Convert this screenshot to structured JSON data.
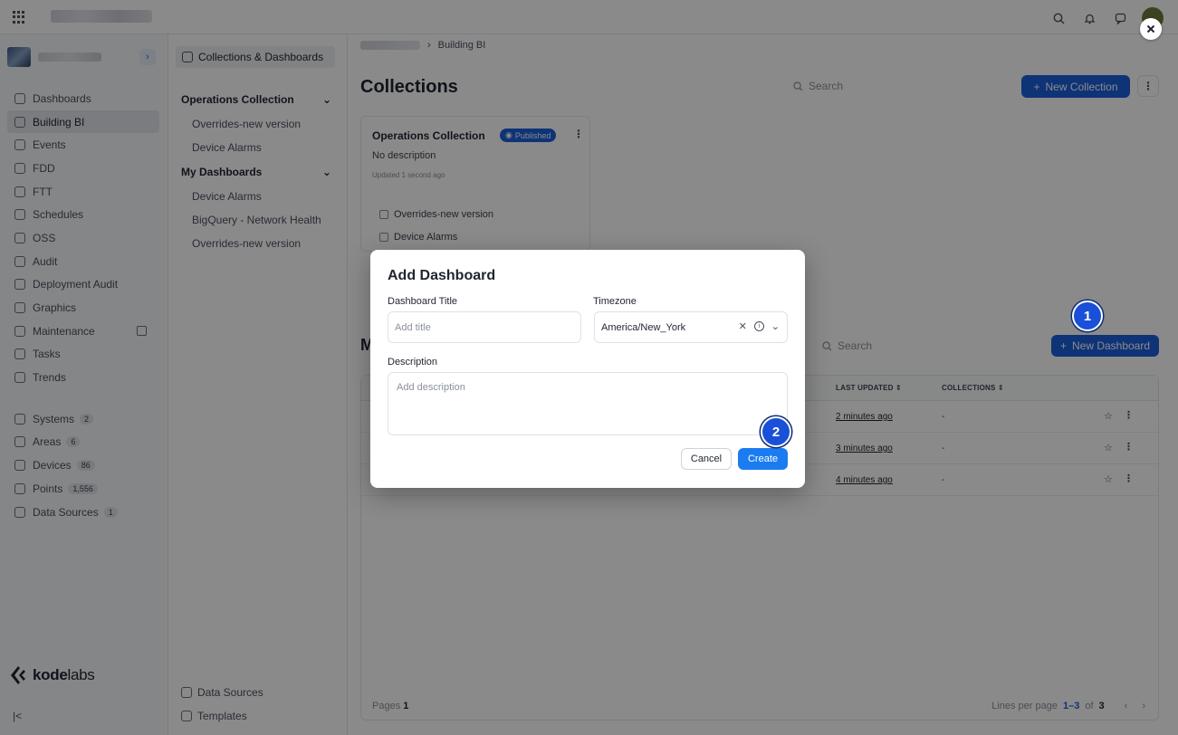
{
  "colors": {
    "accent": "#1a5fdd",
    "create": "#1a7cf0",
    "step_marker": "#1a4fd8"
  },
  "topbar": {
    "icons": [
      "apps-grid-icon",
      "search-icon",
      "bell-icon",
      "chat-icon"
    ]
  },
  "leftnav": {
    "items": [
      {
        "label": "Dashboards",
        "icon": "grid-icon"
      },
      {
        "label": "Building BI",
        "icon": "chart-icon"
      },
      {
        "label": "Events",
        "icon": "events-icon"
      },
      {
        "label": "FDD",
        "icon": "fdd-icon"
      },
      {
        "label": "FTT",
        "icon": "ftt-icon"
      },
      {
        "label": "Schedules",
        "icon": "calendar-icon"
      },
      {
        "label": "OSS",
        "icon": "clock-icon"
      },
      {
        "label": "Audit",
        "icon": "audit-icon"
      },
      {
        "label": "Deployment Audit",
        "icon": "deploy-icon"
      },
      {
        "label": "Graphics",
        "icon": "graphics-icon"
      },
      {
        "label": "Maintenance",
        "icon": "maintenance-icon"
      },
      {
        "label": "Tasks",
        "icon": "tasks-icon"
      },
      {
        "label": "Trends",
        "icon": "trends-icon"
      }
    ],
    "items2": [
      {
        "label": "Systems",
        "badge": "2"
      },
      {
        "label": "Areas",
        "badge": "6"
      },
      {
        "label": "Devices",
        "badge": "86"
      },
      {
        "label": "Points",
        "badge": "1,556"
      },
      {
        "label": "Data Sources",
        "badge": "1"
      }
    ],
    "logo_bold": "kode",
    "logo_light": "labs"
  },
  "secondary": {
    "header": "Collections & Dashboards",
    "group1": "Operations Collection",
    "group1_items": [
      "Overrides-new version",
      "Device Alarms"
    ],
    "group2": "My Dashboards",
    "group2_items": [
      "Device Alarms",
      "BigQuery - Network Health",
      "Overrides-new version"
    ],
    "footer": [
      "Data Sources",
      "Templates"
    ]
  },
  "main": {
    "breadcrumb_current": "Building BI",
    "title": "Collections",
    "search_placeholder": "Search",
    "new_collection": "New Collection",
    "card": {
      "title": "Operations Collection",
      "badge": "Published",
      "description": "No description",
      "updated": "Updated 1 second ago",
      "items": [
        "Overrides-new version",
        "Device Alarms"
      ]
    },
    "section2_partial": "M",
    "search2_placeholder": "Search",
    "new_dashboard": "New Dashboard",
    "table": {
      "columns": [
        "LAST UPDATED",
        "COLLECTIONS"
      ],
      "rows": [
        {
          "updated": "2 minutes ago",
          "collections": "-"
        },
        {
          "updated": "3 minutes ago",
          "collections": "-"
        },
        {
          "updated": "4 minutes ago",
          "collections": "-"
        }
      ],
      "pages_label": "Pages",
      "pages_value": "1",
      "lines_label": "Lines per page",
      "range": "1–3",
      "of": "of",
      "total": "3"
    }
  },
  "modal": {
    "title": "Add Dashboard",
    "title_label": "Dashboard Title",
    "title_placeholder": "Add title",
    "tz_label": "Timezone",
    "tz_value": "America/New_York",
    "desc_label": "Description",
    "desc_placeholder": "Add description",
    "cancel": "Cancel",
    "create": "Create"
  },
  "steps": [
    "1",
    "2"
  ]
}
